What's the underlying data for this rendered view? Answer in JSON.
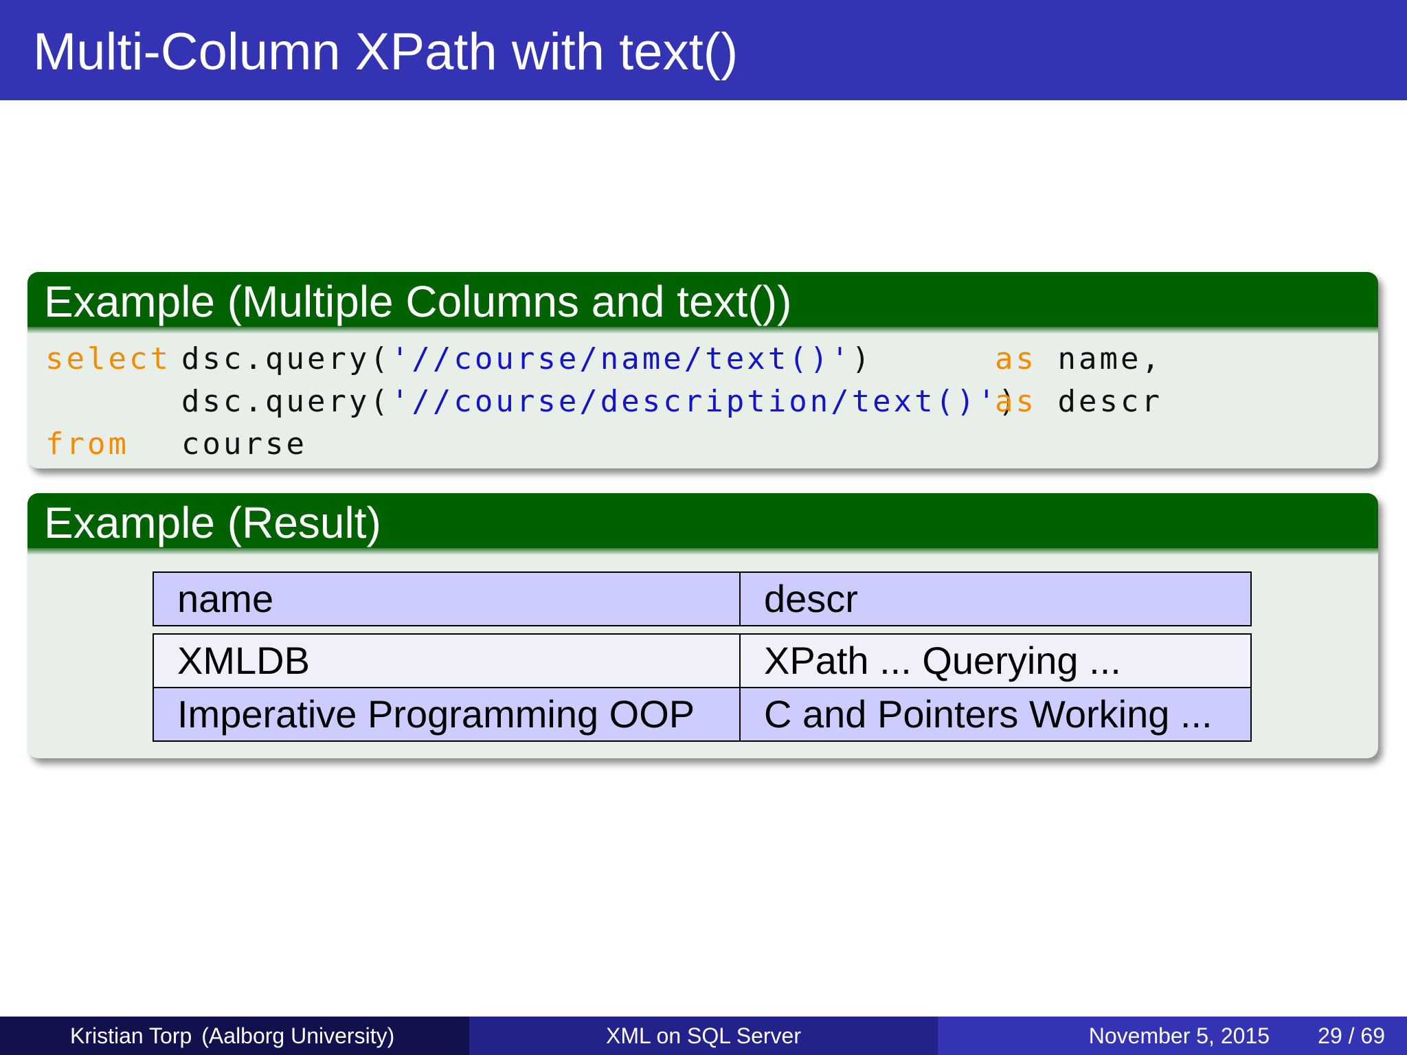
{
  "slide": {
    "title": "Multi-Column XPath with text()"
  },
  "block1": {
    "title": "Example (Multiple Columns and text())",
    "code": {
      "line1": {
        "kw1": "select",
        "expr_pre": "dsc.query(",
        "str": "'//course/name/text()'",
        "expr_post": ")",
        "kw2": "as",
        "alias": "name,"
      },
      "line2": {
        "expr_pre": "dsc.query(",
        "str": "'//course/description/text()'",
        "expr_post": ")",
        "kw2": "as",
        "alias": "descr"
      },
      "line3": {
        "kw1": "from",
        "table": "course"
      }
    }
  },
  "block2": {
    "title": "Example (Result)",
    "table": {
      "headers": [
        "name",
        "descr"
      ],
      "rows": [
        [
          "XMLDB",
          "XPath ... Querying ..."
        ],
        [
          "Imperative Programming OOP",
          "C and Pointers Working ..."
        ]
      ]
    }
  },
  "footer": {
    "author": "Kristian Torp",
    "institution": "(Aalborg University)",
    "talk_title": "XML on SQL Server",
    "date": "November 5, 2015",
    "page": "29 / 69"
  },
  "colors": {
    "title_bar": "#3333b3",
    "block_header": "#006100",
    "block_body": "#e8eee8",
    "keyword": "#f28c00",
    "string": "#1515c8",
    "table_header": "#ccccff"
  }
}
